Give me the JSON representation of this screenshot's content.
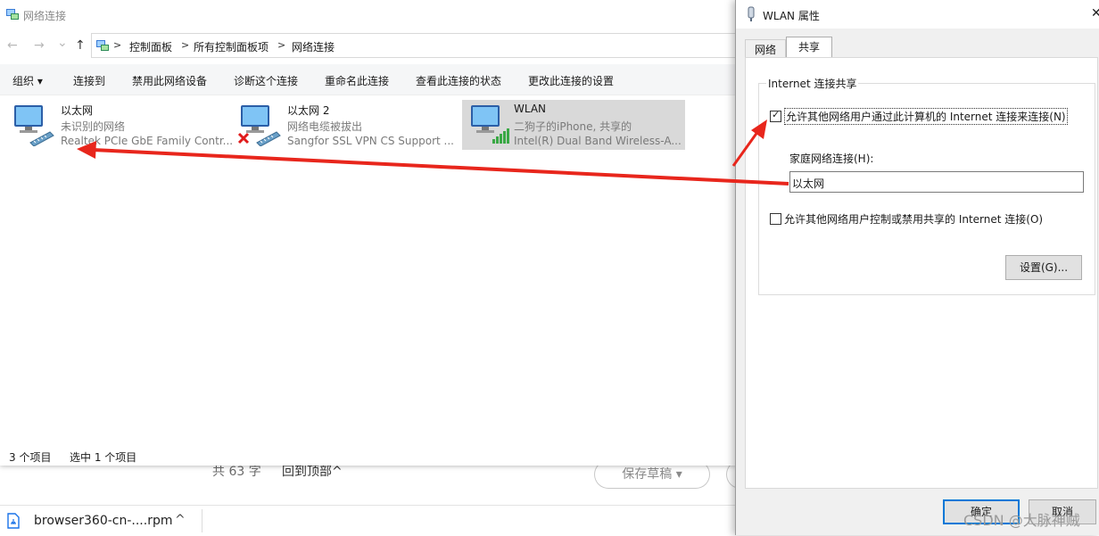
{
  "browser": {
    "footer": {
      "word_count": "共 63 字",
      "back_to_top": "回到顶部^",
      "save_draft": "保存草稿 ▾"
    },
    "download": {
      "file_name": "browser360-cn-....rpm",
      "chevron": "^"
    }
  },
  "explorer": {
    "title": "网络连接",
    "nav": {
      "back": "←",
      "forward": "→",
      "recent": "⌄",
      "up": "↑"
    },
    "breadcrumb": [
      "控制面板",
      "所有控制面板项",
      "网络连接"
    ],
    "breadcrumb_sep": ">",
    "commands": [
      "组织 ▾",
      "连接到",
      "禁用此网络设备",
      "诊断这个连接",
      "重命名此连接",
      "查看此连接的状态",
      "更改此连接的设置"
    ],
    "items": [
      {
        "name": "以太网",
        "status": "未识别的网络",
        "device": "Realtek PCIe GbE Family Contr..."
      },
      {
        "name": "以太网 2",
        "status": "网络电缆被拔出",
        "device": "Sangfor SSL VPN CS Support ..."
      },
      {
        "name": "WLAN",
        "status": "二狗子的iPhone, 共享的",
        "device": "Intel(R) Dual Band Wireless-A..."
      }
    ],
    "status": {
      "count": "3 个项目",
      "selected": "选中 1 个项目"
    }
  },
  "dialog": {
    "title": "WLAN 属性",
    "close": "✕",
    "tabs": [
      "网络",
      "共享"
    ],
    "group_title": "Internet 连接共享",
    "allow_share_label": "允许其他网络用户通过此计算机的 Internet 连接来连接(N)",
    "allow_share_checked": true,
    "home_network_label": "家庭网络连接(H):",
    "home_network_value": "以太网",
    "allow_control_label": "允许其他网络用户控制或禁用共享的 Internet 连接(O)",
    "allow_control_checked": false,
    "settings_button": "设置(G)...",
    "ok_button": "确定",
    "cancel_button": "取消"
  },
  "watermark": "CSDN @大脉神贼",
  "colors": {
    "accent": "#0078d7",
    "arrow": "#e8261c",
    "selected_bg": "#d9d9d9"
  },
  "icons": [
    "network-adapter-icon",
    "disconnected-x-icon",
    "wifi-signal-icon",
    "file-icon",
    "wlan-adapter-icon"
  ]
}
